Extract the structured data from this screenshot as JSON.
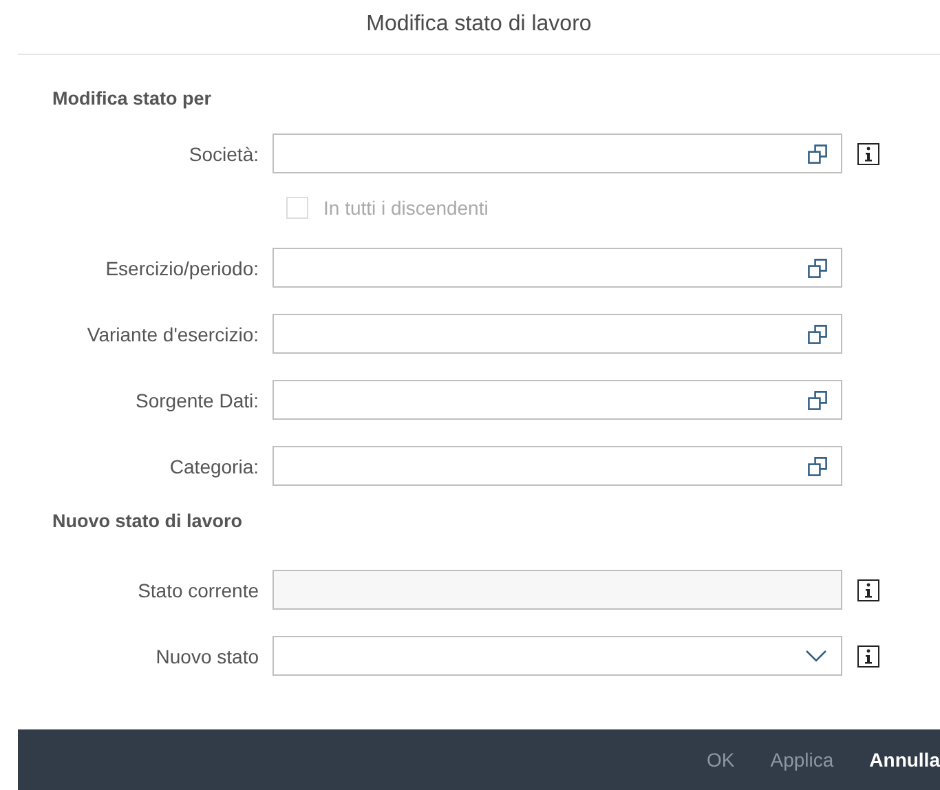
{
  "dialog": {
    "title": "Modifica stato di lavoro"
  },
  "sections": [
    {
      "heading": "Modifica stato per",
      "rows": [
        {
          "kind": "value_help_field",
          "label": "Società:",
          "info": true
        },
        {
          "kind": "checkbox",
          "label": "In tutti i discendenti",
          "checked": false,
          "disabled": true
        },
        {
          "kind": "value_help_field",
          "label": "Esercizio/periodo:",
          "info": false
        },
        {
          "kind": "value_help_field",
          "label": "Variante d'esercizio:",
          "info": false
        },
        {
          "kind": "value_help_field",
          "label": "Sorgente Dati:",
          "info": false
        },
        {
          "kind": "value_help_field",
          "label": "Categoria:",
          "info": false
        }
      ]
    },
    {
      "heading": "Nuovo stato di lavoro",
      "rows": [
        {
          "kind": "readonly_field",
          "label": "Stato corrente",
          "info": true
        },
        {
          "kind": "dropdown_field",
          "label": "Nuovo stato",
          "info": true
        }
      ]
    }
  ],
  "footer": {
    "buttons": [
      {
        "label": "OK",
        "disabled": true
      },
      {
        "label": "Applica",
        "disabled": true
      },
      {
        "label": "Annulla",
        "disabled": false
      }
    ]
  }
}
